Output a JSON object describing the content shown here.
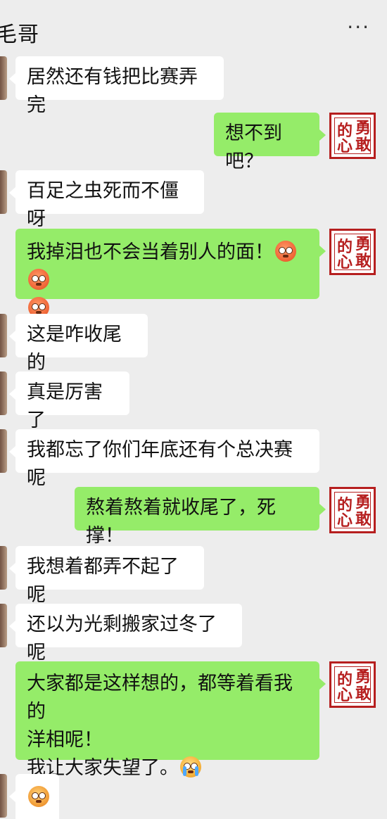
{
  "header": {
    "title": "毛哥",
    "more_icon": "more-dots-icon",
    "more_label": "···"
  },
  "messages": [
    {
      "side": "left",
      "text": "居然还有钱把比赛弄完"
    },
    {
      "side": "right",
      "text": "想不到吧？"
    },
    {
      "side": "left",
      "text": "百足之虫死而不僵呀"
    },
    {
      "side": "right",
      "text_line1": "我掉泪也不会当着别人的面！",
      "emojis_line1": [
        "flushed-emoji",
        "flushed-emoji"
      ],
      "emojis_line2": [
        "flushed-emoji"
      ]
    },
    {
      "side": "left",
      "text": "这是咋收尾的"
    },
    {
      "side": "left",
      "text": "真是厉害了"
    },
    {
      "side": "left",
      "text": "我都忘了你们年底还有个总决赛呢"
    },
    {
      "side": "right",
      "text": "熬着熬着就收尾了，死撑！"
    },
    {
      "side": "left",
      "text": "我想着都弄不起了呢"
    },
    {
      "side": "left",
      "text": "还以为光剩搬家过冬了呢"
    },
    {
      "side": "right",
      "text_line1": "大家都是这样想的，都等着看我的",
      "text_line2": "洋相呢！",
      "text_line3": "我让大家失望了。",
      "emojis_line3": [
        "crying-emoji"
      ]
    },
    {
      "side": "left",
      "emojis": [
        "pleading-emoji"
      ]
    }
  ],
  "self_avatar": {
    "seal_chars": [
      "的",
      "勇",
      "心",
      "敢"
    ],
    "seal_color": "#b61f1f"
  },
  "colors": {
    "background": "#ededed",
    "left_bubble": "#ffffff",
    "right_bubble": "#95ec69"
  }
}
